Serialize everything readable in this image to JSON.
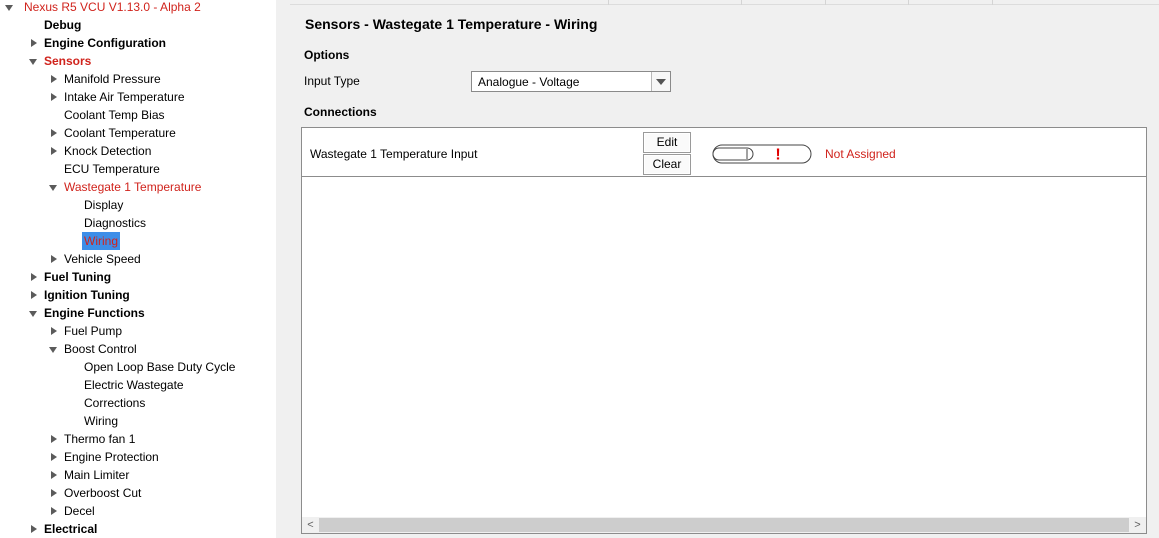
{
  "tree": {
    "items": [
      {
        "label": "Nexus R5 VCU V1.13.0 - Alpha 2",
        "depth": 0,
        "arrow": "expanded",
        "style": "red"
      },
      {
        "label": "Debug",
        "depth": 1,
        "arrow": "none",
        "style": "bold"
      },
      {
        "label": "Engine Configuration",
        "depth": 1,
        "arrow": "collapsed",
        "style": "bold"
      },
      {
        "label": "Sensors",
        "depth": 1,
        "arrow": "expanded",
        "style": "bold-red"
      },
      {
        "label": "Manifold Pressure",
        "depth": 2,
        "arrow": "collapsed",
        "style": "normal"
      },
      {
        "label": "Intake Air Temperature",
        "depth": 2,
        "arrow": "collapsed",
        "style": "normal"
      },
      {
        "label": "Coolant Temp Bias",
        "depth": 2,
        "arrow": "none",
        "style": "normal"
      },
      {
        "label": "Coolant Temperature",
        "depth": 2,
        "arrow": "collapsed",
        "style": "normal"
      },
      {
        "label": "Knock Detection",
        "depth": 2,
        "arrow": "collapsed",
        "style": "normal"
      },
      {
        "label": "ECU Temperature",
        "depth": 2,
        "arrow": "none",
        "style": "normal"
      },
      {
        "label": "Wastegate 1 Temperature",
        "depth": 2,
        "arrow": "expanded",
        "style": "red"
      },
      {
        "label": "Display",
        "depth": 3,
        "arrow": "none",
        "style": "normal"
      },
      {
        "label": "Diagnostics",
        "depth": 3,
        "arrow": "none",
        "style": "normal"
      },
      {
        "label": "Wiring",
        "depth": 3,
        "arrow": "none",
        "style": "selected"
      },
      {
        "label": "Vehicle Speed",
        "depth": 2,
        "arrow": "collapsed",
        "style": "normal"
      },
      {
        "label": "Fuel Tuning",
        "depth": 1,
        "arrow": "collapsed",
        "style": "bold"
      },
      {
        "label": "Ignition Tuning",
        "depth": 1,
        "arrow": "collapsed",
        "style": "bold"
      },
      {
        "label": "Engine Functions",
        "depth": 1,
        "arrow": "expanded",
        "style": "bold"
      },
      {
        "label": "Fuel Pump",
        "depth": 2,
        "arrow": "collapsed",
        "style": "normal"
      },
      {
        "label": "Boost Control",
        "depth": 2,
        "arrow": "expanded",
        "style": "normal"
      },
      {
        "label": "Open Loop Base Duty Cycle",
        "depth": 3,
        "arrow": "none",
        "style": "normal"
      },
      {
        "label": "Electric Wastegate",
        "depth": 3,
        "arrow": "none",
        "style": "normal"
      },
      {
        "label": "Corrections",
        "depth": 3,
        "arrow": "none",
        "style": "normal"
      },
      {
        "label": "Wiring",
        "depth": 3,
        "arrow": "none",
        "style": "normal"
      },
      {
        "label": "Thermo fan 1",
        "depth": 2,
        "arrow": "collapsed",
        "style": "normal"
      },
      {
        "label": "Engine Protection",
        "depth": 2,
        "arrow": "collapsed",
        "style": "normal"
      },
      {
        "label": "Main Limiter",
        "depth": 2,
        "arrow": "collapsed",
        "style": "normal"
      },
      {
        "label": "Overboost Cut",
        "depth": 2,
        "arrow": "collapsed",
        "style": "normal"
      },
      {
        "label": "Decel",
        "depth": 2,
        "arrow": "collapsed",
        "style": "normal"
      },
      {
        "label": "Electrical",
        "depth": 1,
        "arrow": "collapsed",
        "style": "bold"
      }
    ]
  },
  "main": {
    "title": "Sensors - Wastegate 1 Temperature - Wiring",
    "options_heading": "Options",
    "input_type_label": "Input Type",
    "input_type_value": "Analogue - Voltage",
    "connections_heading": "Connections",
    "connection": {
      "label": "Wastegate 1 Temperature Input",
      "edit_label": "Edit",
      "clear_label": "Clear",
      "status": "Not Assigned",
      "warning_glyph": "!"
    },
    "scroll_left": "<",
    "scroll_right": ">"
  },
  "colors": {
    "accent_red": "#d0231c",
    "selection_blue": "#3d8ee8",
    "panel_bg": "#f0f0f0"
  }
}
